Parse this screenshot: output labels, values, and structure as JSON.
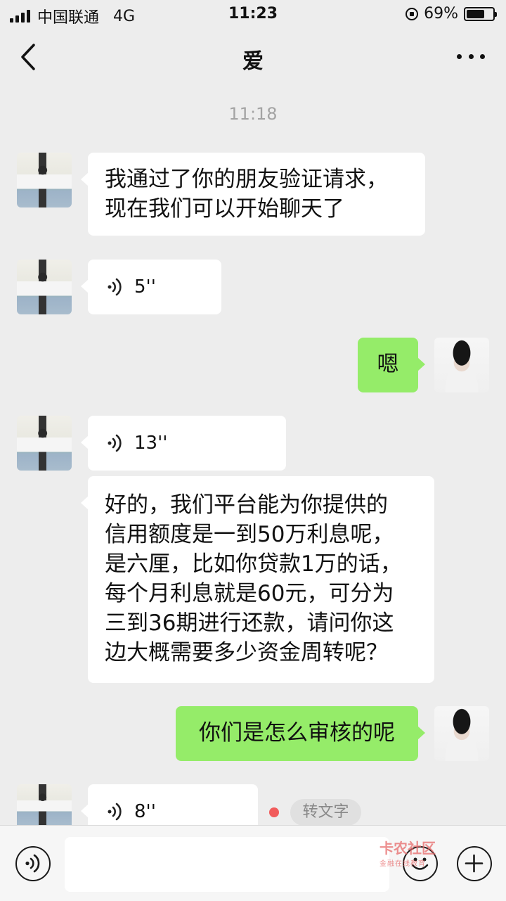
{
  "status_bar": {
    "carrier": "中国联通",
    "network": "4G",
    "time": "11:23",
    "battery_percent": "69%",
    "battery_level": 0.69,
    "icons": [
      "signal-icon",
      "rotation-lock-icon",
      "battery-icon"
    ]
  },
  "nav": {
    "title": "爱",
    "icons": [
      "back-arrow-icon",
      "more-options-icon"
    ]
  },
  "timestamp": "11:18",
  "messages": [
    {
      "side": "left",
      "type": "text",
      "text": "我通过了你的朋友验证请求，\n现在我们可以开始聊天了"
    },
    {
      "side": "left",
      "type": "voice",
      "duration": "5''"
    },
    {
      "side": "right",
      "type": "text",
      "text": "嗯"
    },
    {
      "side": "left",
      "type": "voice",
      "duration": "13''"
    },
    {
      "side": "left",
      "type": "text",
      "text": "好的，我们平台能为你提供的\n信用额度是一到50万利息呢，\n是六厘，比如你贷款1万的话，\n每个月利息就是60元，可分为\n三到36期进行还款，请问你这\n边大概需要多少资金周转呢？"
    },
    {
      "side": "right",
      "type": "text",
      "text": "你们是怎么审核的呢"
    },
    {
      "side": "left",
      "type": "voice",
      "duration": "8''",
      "unread": true,
      "action_label": "转文字"
    }
  ],
  "input_bar": {
    "placeholder": "",
    "icons": [
      "voice-input-icon",
      "emoji-icon",
      "plus-icon"
    ]
  },
  "watermark": {
    "text": "卡农社区",
    "subtext": "金融在线教育"
  },
  "colors": {
    "self_bubble": "#95ec69",
    "other_bubble": "#ffffff",
    "background": "#ededed",
    "unread_dot": "#f15b5b"
  }
}
